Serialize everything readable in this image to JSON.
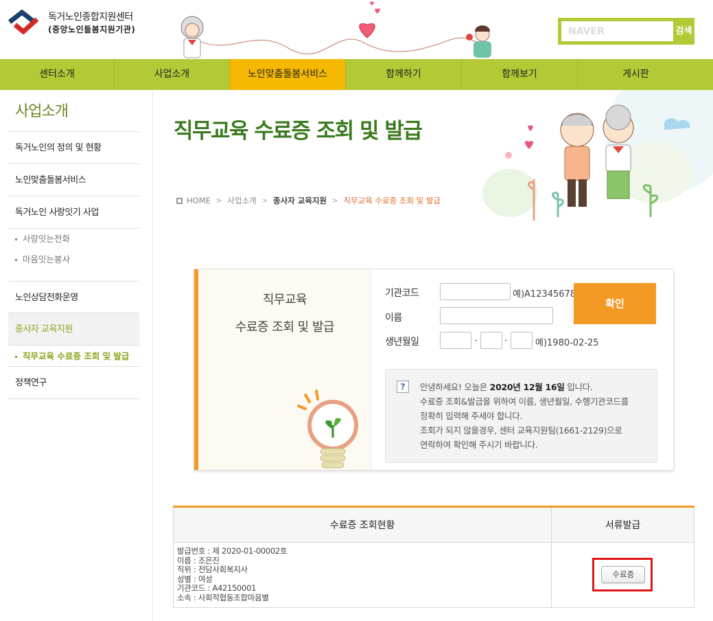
{
  "header": {
    "logo_line1": "독거노인종합지원센터",
    "logo_line2": "(중앙노인돌봄지원기관)",
    "search_placeholder": "NAVER",
    "search_button": "검색"
  },
  "nav": {
    "items": [
      {
        "label": "센터소개"
      },
      {
        "label": "사업소개"
      },
      {
        "label": "노인맞춤돌봄서비스"
      },
      {
        "label": "함께하기"
      },
      {
        "label": "함께보기"
      },
      {
        "label": "게시판"
      }
    ],
    "active_index": 2
  },
  "sidebar": {
    "title": "사업소개",
    "items": [
      {
        "label": "독거노인의 정의 및 현황"
      },
      {
        "label": "노인맞춤돌봄서비스"
      },
      {
        "label": "독거노인 사랑잇기 사업"
      },
      {
        "label": "사랑잇는전화"
      },
      {
        "label": "마음잇는봉사"
      },
      {
        "label": "노인상담전화운영"
      },
      {
        "label": "종사자 교육지원"
      },
      {
        "label": "직무교육 수료증 조회 및 발급"
      },
      {
        "label": "정책연구"
      }
    ]
  },
  "banner": {
    "title": "직무교육 수료증 조회 및 발급",
    "breadcrumb": [
      "HOME",
      "사업소개",
      "종사자 교육지원",
      "직무교육 수료증 조회 및 발급"
    ]
  },
  "form": {
    "left_title1": "직무교육",
    "left_title2": "수료증 조회 및 발급",
    "org_code_label": "기관코드",
    "org_code_hint": "예)A12345678",
    "name_label": "이름",
    "birth_label": "생년월일",
    "birth_hint": "예)1980-02-25",
    "birth_sep": "-",
    "confirm_button": "확인",
    "notice": {
      "line1_pre": "안녕하세요! 오늘은 ",
      "line1_date": "2020년 12월 16일",
      "line1_post": " 입니다.",
      "line2": "수료증 조회&발급을 위하여 이름, 생년월일, 수행기관코드를",
      "line3": "정확히 입력해 주세야 합니다.",
      "line4": "조회가 되지 않을경우, 센터 교육지원팀(1661-2129)으로",
      "line5": "연락하여 확인해 주시기 바랍니다."
    }
  },
  "results": {
    "col_status": "수료증 조회현황",
    "col_issue": "서류발급",
    "row": {
      "issue_no": "발급번호 : 제 2020-01-00002호",
      "name": "이름 : 조은진",
      "position": "직위 : 전담사회복지사",
      "gender": "성별 : 여성",
      "org_code": "기관코드 : A42150001",
      "affiliation": "소속 : 사회적협동조합마음별",
      "issue_button": "수료증"
    }
  },
  "colors": {
    "nav_green": "#b3c935",
    "nav_active": "#f6b800",
    "accent_orange": "#f39a25",
    "title_green": "#3b7a1e",
    "highlight_red": "#e0161b"
  }
}
